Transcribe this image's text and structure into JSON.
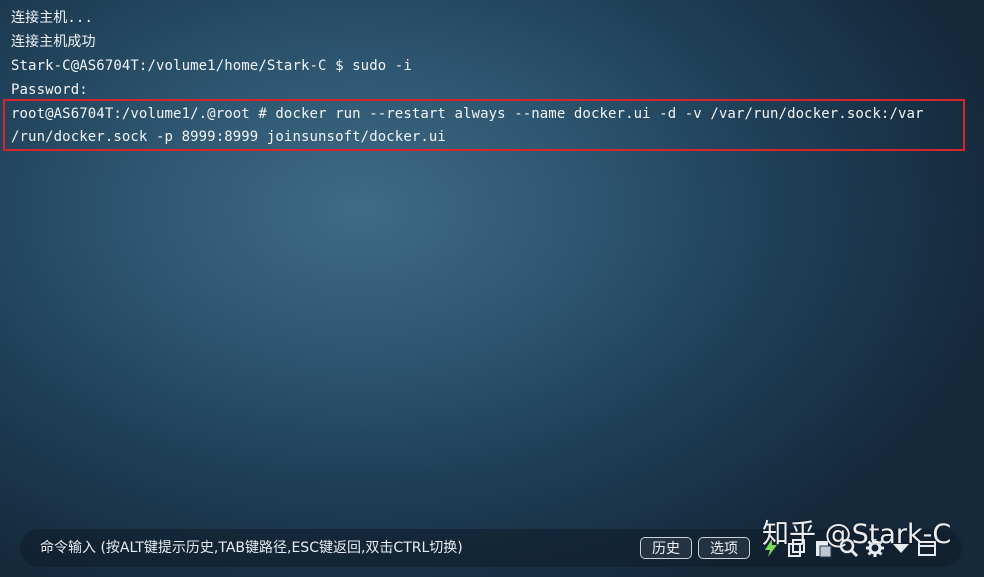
{
  "terminal": {
    "lines": [
      "连接主机...",
      "连接主机成功",
      "Stark-C@AS6704T:/volume1/home/Stark-C $ sudo -i",
      "Password:",
      "root@AS6704T:/volume1/.@root # docker run --restart always --name docker.ui -d -v /var/run/docker.sock:/var",
      "/run/docker.sock -p 8999:8999 joinsunsoft/docker.ui"
    ]
  },
  "command_bar": {
    "placeholder": "命令输入 (按ALT键提示历史,TAB键路径,ESC键返回,双击CTRL切换)",
    "history_label": "历史",
    "options_label": "选项"
  },
  "watermark": "知乎 @Stark-C",
  "colors": {
    "highlight_border": "#d4262b",
    "text": "#f2f4f6",
    "background": "#2e5670"
  },
  "icons": [
    "lightning-icon",
    "copy-icon",
    "paste-icon",
    "search-icon",
    "gear-icon",
    "arrow-down-icon",
    "window-icon"
  ]
}
